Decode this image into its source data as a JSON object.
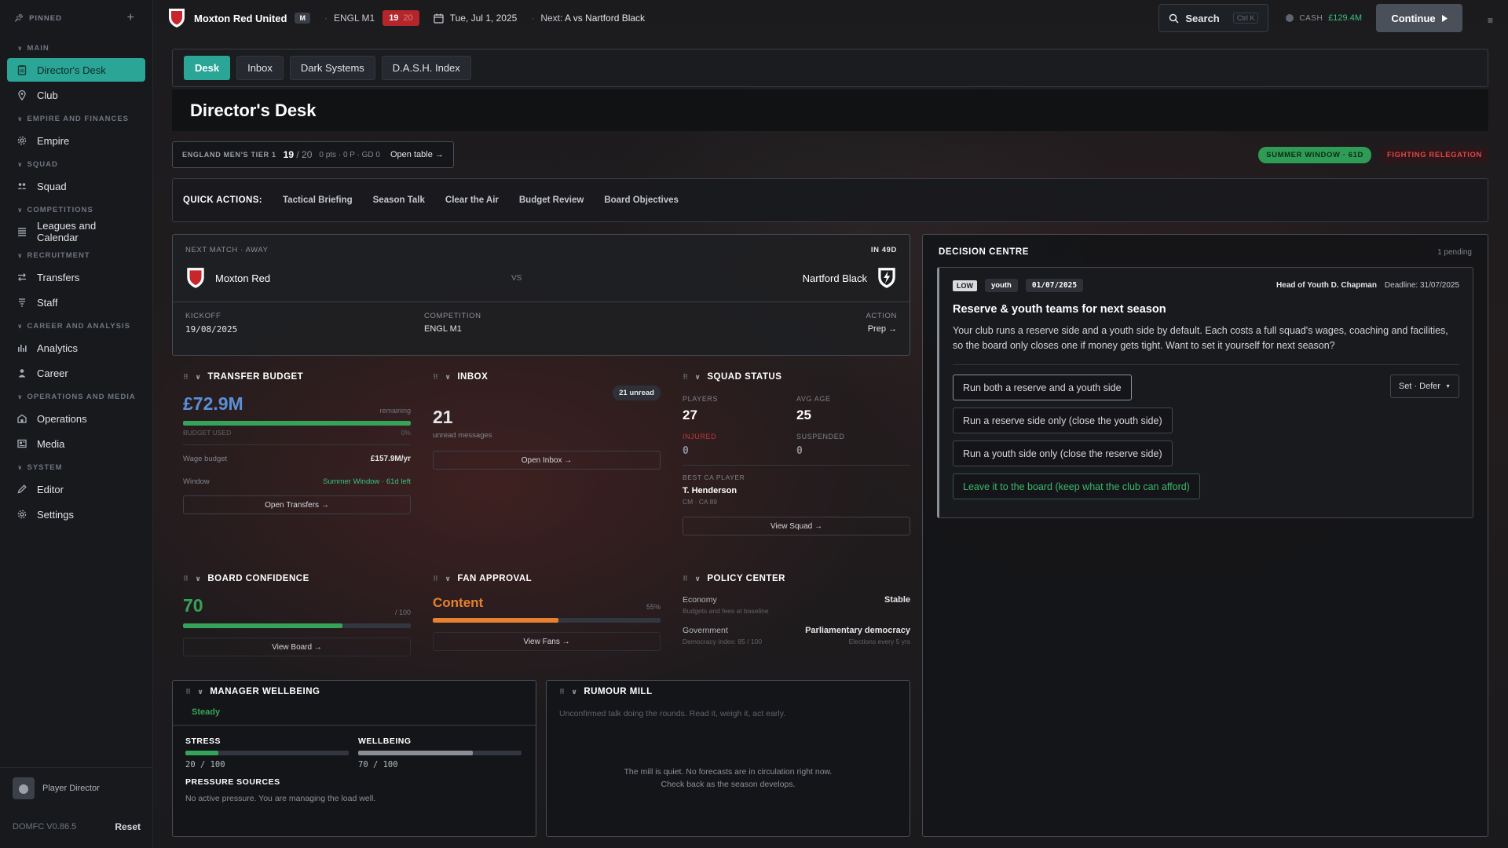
{
  "sidebar": {
    "pinned_label": "PINNED",
    "sections": [
      {
        "label": "MAIN",
        "items": [
          {
            "label": "Director's Desk",
            "icon": "clipboard-icon",
            "active": true
          },
          {
            "label": "Club",
            "icon": "location-pin-icon"
          }
        ]
      },
      {
        "label": "EMPIRE AND FINANCES",
        "items": [
          {
            "label": "Empire",
            "icon": "gear-icon"
          }
        ]
      },
      {
        "label": "SQUAD",
        "items": [
          {
            "label": "Squad",
            "icon": "people-icon"
          }
        ]
      },
      {
        "label": "COMPETITIONS",
        "items": [
          {
            "label": "Leagues and Calendar",
            "icon": "list-icon"
          }
        ]
      },
      {
        "label": "RECRUITMENT",
        "items": [
          {
            "label": "Transfers",
            "icon": "transfer-arrows-icon"
          },
          {
            "label": "Staff",
            "icon": "staff-icon"
          }
        ]
      },
      {
        "label": "CAREER AND ANALYSIS",
        "items": [
          {
            "label": "Analytics",
            "icon": "bar-chart-icon"
          },
          {
            "label": "Career",
            "icon": "person-icon"
          }
        ]
      },
      {
        "label": "OPERATIONS AND MEDIA",
        "items": [
          {
            "label": "Operations",
            "icon": "building-icon"
          },
          {
            "label": "Media",
            "icon": "newspaper-icon"
          }
        ]
      },
      {
        "label": "SYSTEM",
        "items": [
          {
            "label": "Editor",
            "icon": "pencil-icon"
          },
          {
            "label": "Settings",
            "icon": "gear-icon"
          }
        ]
      }
    ],
    "user_name": "Player Director",
    "version": "DOMFC V0.86.5",
    "reset_label": "Reset"
  },
  "topbar": {
    "club_name": "Moxton Red United",
    "gender_badge": "M",
    "league": "ENGL M1",
    "position": "19",
    "position_of": "20",
    "date": "Tue, Jul 1, 2025",
    "next_label": "Next:",
    "next_venue": "A",
    "next_opponent": "vs Nartford Black",
    "search_label": "Search",
    "search_shortcut": "Ctrl K",
    "cash_label": "CASH",
    "cash_value": "£129.4M",
    "continue_label": "Continue"
  },
  "tabs": [
    "Desk",
    "Inbox",
    "Dark Systems",
    "D.A.S.H. Index"
  ],
  "page_title": "Director's Desk",
  "league_table": {
    "name": "ENGLAND MEN'S TIER 1",
    "rank": "19",
    "rank_of": "/ 20",
    "stats": "0 pts · 0 P · GD 0",
    "open_label": "Open table →"
  },
  "status_pills": {
    "window": "SUMMER WINDOW · 61D",
    "situation": "FIGHTING RELEGATION"
  },
  "quick_actions": {
    "label": "QUICK ACTIONS:",
    "items": [
      "Tactical Briefing",
      "Season Talk",
      "Clear the Air",
      "Budget Review",
      "Board Objectives"
    ]
  },
  "next_match": {
    "header": "NEXT MATCH · AWAY",
    "countdown": "IN 49D",
    "home": "Moxton Red",
    "vs": "VS",
    "away": "Nartford Black",
    "kickoff_label": "KICKOFF",
    "kickoff": "19/08/2025",
    "competition_label": "COMPETITION",
    "competition": "ENGL M1",
    "action_label": "ACTION",
    "action": "Prep →"
  },
  "transfer_budget": {
    "title": "TRANSFER BUDGET",
    "value": "£72.9M",
    "remaining_label": "remaining",
    "used_label": "BUDGET USED",
    "used_pct": "0%",
    "remaining_fraction": 1.0,
    "wage_label": "Wage budget",
    "wage_value": "£157.9M/yr",
    "window_label": "Window",
    "window_value": "Summer Window · 61d left",
    "button": "Open Transfers →"
  },
  "inbox": {
    "title": "INBOX",
    "unread_badge": "21 unread",
    "count": "21",
    "count_label": "unread messages",
    "button": "Open Inbox →"
  },
  "squad_status": {
    "title": "SQUAD STATUS",
    "players_label": "PLAYERS",
    "players": "27",
    "avg_age_label": "AVG AGE",
    "avg_age": "25",
    "injured_label": "INJURED",
    "injured": "0",
    "suspended_label": "SUSPENDED",
    "suspended": "0",
    "best_label": "BEST CA PLAYER",
    "best_name": "T. Henderson",
    "best_meta": "CM · CA 89",
    "button": "View Squad →"
  },
  "board_confidence": {
    "title": "BOARD CONFIDENCE",
    "value": "70",
    "max": "/ 100",
    "fraction": 0.7,
    "button": "View Board →"
  },
  "fan_approval": {
    "title": "FAN APPROVAL",
    "value": "Content",
    "pct": "55%",
    "fraction": 0.55,
    "button": "View Fans →"
  },
  "policy_center": {
    "title": "POLICY CENTER",
    "economy_label": "Economy",
    "economy_value": "Stable",
    "economy_sub": "Budgets and fees at baseline",
    "government_label": "Government",
    "government_value": "Parliamentary democracy",
    "government_sub": "Democracy index: 85 / 100",
    "government_sub2": "Elections every 5 yrs"
  },
  "wellbeing": {
    "title": "MANAGER WELLBEING",
    "status": "Steady",
    "stress_label": "STRESS",
    "stress_value": "20 / 100",
    "stress_fraction": 0.2,
    "wellbeing_label": "WELLBEING",
    "wellbeing_value": "70 / 100",
    "wellbeing_fraction": 0.7,
    "pressure_label": "PRESSURE SOURCES",
    "pressure_text": "No active pressure. You are managing the load well."
  },
  "rumour_mill": {
    "title": "RUMOUR MILL",
    "intro": "Unconfirmed talk doing the rounds. Read it, weigh it, act early.",
    "empty_line1": "The mill is quiet. No forecasts are in circulation right now.",
    "empty_line2": "Check back as the season develops."
  },
  "decision_centre": {
    "title": "DECISION CENTRE",
    "pending": "1 pending",
    "priority": "LOW",
    "category": "youth",
    "date": "01/07/2025",
    "from": "Head of Youth D. Chapman",
    "deadline": "Deadline: 31/07/2025",
    "subject": "Reserve & youth teams for next season",
    "body": "Your club runs a reserve side and a youth side by default. Each costs a full squad's wages, coaching and facilities, so the board only closes one if money gets tight. Want to set it yourself for next season?",
    "options": [
      "Run both a reserve and a youth side",
      "Run a reserve side only (close the youth side)",
      "Run a youth side only (close the reserve side)",
      "Leave it to the board (keep what the club can afford)"
    ],
    "defer_label": "Set · Defer"
  },
  "colors": {
    "accent": "#2aa596",
    "positive": "#39c27c",
    "danger": "#e0464c",
    "budget_blue": "#5b8fd6",
    "warning": "#e7812f"
  }
}
